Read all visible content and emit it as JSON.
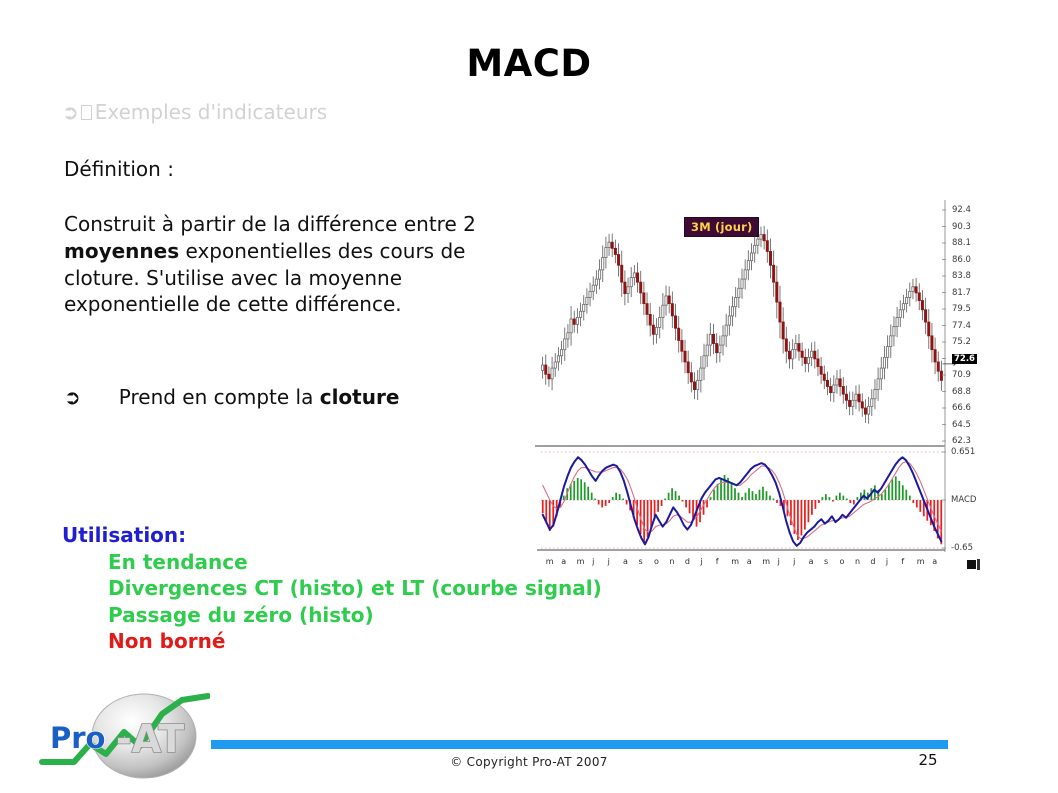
{
  "slide": {
    "title": "MACD",
    "subtitle": "Exemples d'indicateurs",
    "subtitle_arrow": "➲",
    "definition_label": "Définition :",
    "paragraph_part1": "Construit à partir de la différence entre 2 ",
    "paragraph_bold": "moyennes",
    "paragraph_part2": " exponentielles des cours de cloture. S'utilise avec la moyenne exponentielle de cette différence.",
    "bullet_arrow": "➲",
    "bullet_text": "Prend en compte la ",
    "bullet_bold": "cloture",
    "utilisation": {
      "heading": "Utilisation:",
      "items": [
        "En tendance",
        "Divergences CT (histo) et LT (courbe signal)",
        "Passage du zéro (histo)"
      ],
      "last_item": "Non borné",
      "heading_color": "#1f1fd0",
      "item_color": "#2fcc4e",
      "last_item_color": "#e01b18"
    }
  },
  "footer": {
    "copyright": "© Copyright  Pro-AT 2007",
    "page_number": "25",
    "bar_color": "#1e9bf0",
    "logo_text_primary": "Pro",
    "logo_text_secondary": "-AT"
  },
  "chart_data": {
    "type": "line",
    "title": "3M (jour)",
    "badge_bg": "#3d0b33",
    "badge_fg": "#ffd24a",
    "panels": [
      {
        "name": "price",
        "type": "candlestick",
        "ylabels": [
          "92.4",
          "90.3",
          "88.1",
          "86.0",
          "83.8",
          "81.7",
          "79.5",
          "77.4",
          "75.2",
          "72.6",
          "70.9",
          "68.8",
          "66.6",
          "64.5",
          "62.3"
        ],
        "highlighted_label": "72.6",
        "ylim": [
          62.3,
          92.4
        ],
        "up_color": "#ffffff",
        "down_color": "#8f1515",
        "wick_color": "#6a6a6a",
        "opens": [
          71.5,
          72.2,
          71.0,
          70.4,
          71.8,
          72.6,
          73.4,
          74.2,
          75.6,
          76.4,
          78.2,
          77.5,
          78.4,
          79.2,
          80.1,
          81.0,
          81.8,
          82.6,
          83.4,
          84.6,
          86.2,
          87.5,
          88.2,
          87.4,
          86.6,
          85.2,
          83.0,
          81.5,
          82.4,
          83.6,
          84.2,
          83.0,
          81.6,
          80.2,
          78.8,
          77.4,
          76.2,
          77.1,
          78.4,
          80.0,
          81.2,
          80.2,
          78.6,
          77.0,
          75.4,
          74.0,
          72.6,
          71.2,
          70.0,
          69.0,
          70.2,
          71.8,
          73.4,
          74.8,
          76.2,
          75.0,
          73.8,
          74.8,
          76.0,
          77.4,
          78.6,
          79.8,
          81.0,
          82.2,
          83.4,
          84.6,
          85.8,
          86.8,
          87.8,
          88.6,
          89.2,
          88.4,
          87.0,
          85.2,
          83.0,
          80.4,
          77.8,
          75.6,
          74.0,
          73.0,
          74.2,
          75.0,
          74.0,
          73.2,
          72.4,
          73.2,
          74.0,
          73.0,
          72.0,
          71.0,
          70.2,
          69.4,
          68.6,
          69.6,
          70.4,
          69.4,
          68.4,
          67.6,
          66.8,
          67.6,
          68.4,
          67.4,
          66.6,
          65.8,
          66.8,
          67.8,
          69.0,
          70.4,
          71.8,
          73.2,
          74.6,
          76.0,
          77.2,
          78.4,
          79.4,
          80.2,
          81.0,
          81.8,
          82.4,
          81.6,
          80.6,
          79.4,
          77.8,
          76.0,
          74.2,
          72.6,
          71.4
        ],
        "closes": [
          72.2,
          71.0,
          70.4,
          71.8,
          72.6,
          73.4,
          74.2,
          75.6,
          76.4,
          78.2,
          77.5,
          78.4,
          79.2,
          80.1,
          81.0,
          81.8,
          82.6,
          83.4,
          84.6,
          86.2,
          87.5,
          88.2,
          87.4,
          86.6,
          85.2,
          83.0,
          81.5,
          82.4,
          83.6,
          84.2,
          83.0,
          81.6,
          80.2,
          78.8,
          77.4,
          76.2,
          77.1,
          78.4,
          80.0,
          81.2,
          80.2,
          78.6,
          77.0,
          75.4,
          74.0,
          72.6,
          71.2,
          70.0,
          69.0,
          70.2,
          71.8,
          73.4,
          74.8,
          76.2,
          75.0,
          73.8,
          74.8,
          76.0,
          77.4,
          78.6,
          79.8,
          81.0,
          82.2,
          83.4,
          84.6,
          85.8,
          86.8,
          87.8,
          88.6,
          89.2,
          88.4,
          87.0,
          85.2,
          83.0,
          80.4,
          77.8,
          75.6,
          74.0,
          73.0,
          74.2,
          75.0,
          74.0,
          73.2,
          72.4,
          73.2,
          74.0,
          73.0,
          72.0,
          71.0,
          70.2,
          69.4,
          68.6,
          69.6,
          70.4,
          69.4,
          68.4,
          67.6,
          66.8,
          67.6,
          68.4,
          67.4,
          66.6,
          65.8,
          66.8,
          67.8,
          69.0,
          70.4,
          71.8,
          73.2,
          74.6,
          76.0,
          77.2,
          78.4,
          79.4,
          80.2,
          81.0,
          81.8,
          82.4,
          81.6,
          80.6,
          79.4,
          77.8,
          76.0,
          74.2,
          72.6,
          71.4,
          70.2
        ]
      },
      {
        "name": "macd",
        "type": "macd",
        "ylabels": [
          "0.651",
          "MACD",
          "-0.65"
        ],
        "ylim": [
          -0.65,
          0.651
        ],
        "histogram_positive_color": "#1f9b27",
        "histogram_negative_color": "#e82020",
        "macd_line_color": "#1a1a9e",
        "signal_line_color": "#d4708a",
        "histogram": [
          -0.18,
          -0.3,
          -0.42,
          -0.36,
          -0.22,
          -0.1,
          0.06,
          0.16,
          0.22,
          0.26,
          0.3,
          0.28,
          0.24,
          0.18,
          0.1,
          0.02,
          -0.06,
          -0.1,
          -0.08,
          -0.04,
          0.04,
          0.1,
          0.08,
          0.02,
          -0.06,
          -0.14,
          -0.24,
          -0.34,
          -0.46,
          -0.58,
          -0.5,
          -0.38,
          -0.26,
          -0.16,
          -0.08,
          0.02,
          0.1,
          0.16,
          0.12,
          0.06,
          -0.02,
          -0.1,
          -0.18,
          -0.28,
          -0.36,
          -0.3,
          -0.2,
          -0.1,
          0.04,
          0.14,
          0.22,
          0.28,
          0.34,
          0.3,
          0.24,
          0.16,
          0.1,
          0.04,
          0.1,
          0.16,
          0.12,
          0.08,
          0.14,
          0.18,
          0.12,
          0.06,
          0.02,
          -0.04,
          -0.08,
          -0.14,
          -0.22,
          -0.34,
          -0.46,
          -0.54,
          -0.48,
          -0.4,
          -0.3,
          -0.2,
          -0.12,
          -0.04,
          0.04,
          0.08,
          0.04,
          -0.02,
          0.06,
          0.1,
          0.06,
          0.02,
          -0.04,
          -0.06,
          0.04,
          0.1,
          0.14,
          0.1,
          0.16,
          0.2,
          0.14,
          0.08,
          0.14,
          0.22,
          0.28,
          0.32,
          0.26,
          0.2,
          0.14,
          0.06,
          -0.04,
          -0.1,
          -0.16,
          -0.22,
          -0.28,
          -0.34,
          -0.42,
          -0.52,
          -0.6
        ],
        "macd_line": [
          -0.2,
          -0.3,
          -0.4,
          -0.34,
          -0.18,
          0.0,
          0.18,
          0.32,
          0.44,
          0.52,
          0.58,
          0.54,
          0.48,
          0.4,
          0.32,
          0.26,
          0.34,
          0.4,
          0.44,
          0.46,
          0.48,
          0.46,
          0.38,
          0.26,
          0.1,
          -0.08,
          -0.26,
          -0.4,
          -0.52,
          -0.6,
          -0.5,
          -0.34,
          -0.2,
          -0.28,
          -0.36,
          -0.3,
          -0.2,
          -0.1,
          -0.16,
          -0.24,
          -0.34,
          -0.4,
          -0.34,
          -0.22,
          -0.1,
          0.02,
          0.1,
          0.16,
          0.22,
          0.28,
          0.3,
          0.28,
          0.26,
          0.24,
          0.22,
          0.2,
          0.24,
          0.3,
          0.36,
          0.42,
          0.46,
          0.48,
          0.5,
          0.48,
          0.42,
          0.34,
          0.24,
          0.1,
          -0.08,
          -0.28,
          -0.44,
          -0.56,
          -0.62,
          -0.58,
          -0.5,
          -0.44,
          -0.4,
          -0.36,
          -0.3,
          -0.26,
          -0.32,
          -0.28,
          -0.22,
          -0.3,
          -0.26,
          -0.2,
          -0.24,
          -0.18,
          -0.12,
          -0.06,
          0.0,
          0.06,
          0.02,
          0.08,
          0.14,
          0.1,
          0.16,
          0.24,
          0.32,
          0.4,
          0.48,
          0.54,
          0.58,
          0.54,
          0.46,
          0.36,
          0.24,
          0.12,
          0.0,
          -0.12,
          -0.24,
          -0.36,
          -0.46,
          -0.56
        ],
        "signal_line": [
          0.2,
          0.1,
          0.0,
          -0.08,
          -0.12,
          -0.1,
          -0.02,
          0.1,
          0.22,
          0.32,
          0.4,
          0.44,
          0.44,
          0.42,
          0.4,
          0.38,
          0.38,
          0.38,
          0.4,
          0.42,
          0.44,
          0.44,
          0.42,
          0.36,
          0.28,
          0.16,
          0.02,
          -0.14,
          -0.28,
          -0.4,
          -0.44,
          -0.42,
          -0.36,
          -0.34,
          -0.34,
          -0.32,
          -0.28,
          -0.22,
          -0.2,
          -0.22,
          -0.26,
          -0.3,
          -0.3,
          -0.26,
          -0.2,
          -0.12,
          -0.04,
          0.04,
          0.12,
          0.18,
          0.22,
          0.24,
          0.24,
          0.24,
          0.22,
          0.2,
          0.2,
          0.24,
          0.28,
          0.34,
          0.38,
          0.42,
          0.46,
          0.46,
          0.44,
          0.4,
          0.34,
          0.24,
          0.12,
          -0.04,
          -0.2,
          -0.34,
          -0.46,
          -0.52,
          -0.52,
          -0.5,
          -0.46,
          -0.42,
          -0.38,
          -0.34,
          -0.32,
          -0.3,
          -0.28,
          -0.28,
          -0.26,
          -0.24,
          -0.24,
          -0.22,
          -0.18,
          -0.14,
          -0.1,
          -0.06,
          -0.04,
          -0.02,
          0.02,
          0.04,
          0.08,
          0.14,
          0.2,
          0.28,
          0.36,
          0.44,
          0.5,
          0.52,
          0.5,
          0.44,
          0.36,
          0.26,
          0.14,
          0.02,
          -0.1,
          -0.22,
          -0.32,
          -0.42
        ]
      }
    ],
    "xlabels": [
      "m",
      "a",
      "m",
      "j",
      "j",
      "a",
      "s",
      "o",
      "n",
      "d",
      "j",
      "f",
      "m",
      "a",
      "m",
      "j",
      "j",
      "a",
      "s",
      "o",
      "n",
      "d",
      "j",
      "f",
      "m",
      "a"
    ],
    "xlabel": "",
    "grid": true
  }
}
